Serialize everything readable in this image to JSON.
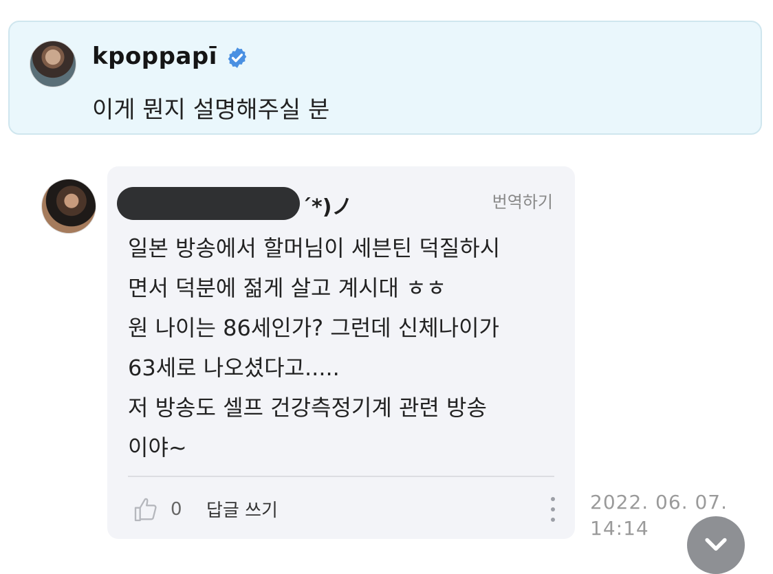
{
  "post": {
    "author": "kpoppapī",
    "text": "이게 뭔지 설명해주실 분",
    "verified_icon": "verified-badge-icon",
    "verified_color": "#4a90e2"
  },
  "comment": {
    "name_suffix": "´*)ノ",
    "translate_label": "번역하기",
    "body": "일본 방송에서 할머님이 세븐틴 덕질하시\n면서 덕분에 젊게 살고 계시대 ㅎㅎ\n원 나이는 86세인가? 그런데 신체나이가\n63세로 나오셨다고.....\n저 방송도 셀프 건강측정기계 관련 방송\n이야~",
    "like_count": "0",
    "reply_label": "답글 쓰기",
    "timestamp": "2022. 06. 07.\n14:14",
    "icons": {
      "like": "thumbs-up-icon",
      "more": "more-vertical-icon",
      "scroll": "chevron-down-icon"
    }
  },
  "colors": {
    "post_bg": "#eaf7fc",
    "comment_bg": "#f3f4f8",
    "muted_text": "#9a9a9a"
  }
}
